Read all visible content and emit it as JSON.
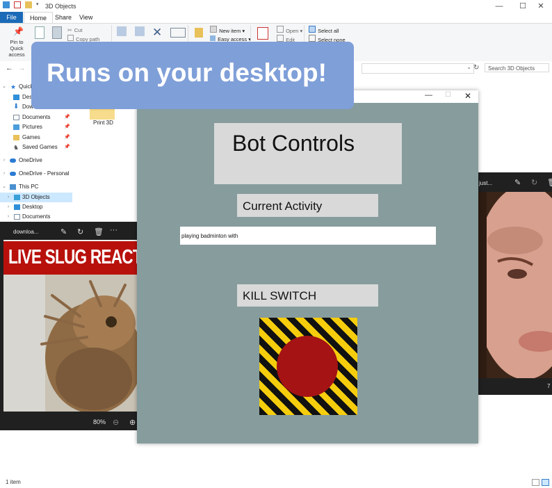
{
  "explorer": {
    "window_title": "3D Objects",
    "tabs": [
      "File",
      "Home",
      "Share",
      "View"
    ],
    "ribbon": {
      "pin_label": "Pin to Quick access",
      "copy_label": "Copy",
      "paste_label": "Paste",
      "cut_label": "Cut",
      "copy_path_label": "Copy path",
      "move_to_label": "Move",
      "copy_to_label": "Copy",
      "delete_label": "Delete",
      "rename_label": "Rename",
      "new_folder_label": "New",
      "new_item_label": "New item",
      "easy_access_label": "Easy access",
      "properties_label": "Properties",
      "open_label": "Open",
      "edit_label": "Edit",
      "select_all_label": "Select all",
      "select_none_label": "Select none"
    },
    "search_placeholder": "Search 3D Objects",
    "nav": [
      {
        "label": "Quick",
        "pinned": false
      },
      {
        "label": "Des",
        "pinned": false
      },
      {
        "label": "Dow",
        "pinned": false
      },
      {
        "label": "Documents",
        "pinned": true
      },
      {
        "label": "Pictures",
        "pinned": true
      },
      {
        "label": "Games",
        "pinned": true
      },
      {
        "label": "Saved Games",
        "pinned": true
      },
      {
        "label": "OneDrive",
        "pinned": false
      },
      {
        "label": "OneDrive - Personal",
        "pinned": false
      },
      {
        "label": "This PC",
        "pinned": false
      },
      {
        "label": "3D Objects",
        "pinned": false
      },
      {
        "label": "Desktop",
        "pinned": false
      },
      {
        "label": "Documents",
        "pinned": false
      }
    ],
    "folder_label": "Print 3D",
    "status": "1 item"
  },
  "photo_left": {
    "title": "downloa...",
    "image_text": "LIVE SLUG REACT",
    "zoom": "80%"
  },
  "photo_right": {
    "title": "just...",
    "number_partial": "7"
  },
  "bot_window": {
    "title": "Bot Controls",
    "activity_label": "Current Activity",
    "activity_value": "playing badminton with",
    "killswitch_label": "KILL SWITCH"
  },
  "promo": {
    "text": "Runs on your desktop!"
  },
  "colors": {
    "explorer_accent": "#1a6ab8",
    "bot_background": "#879c9d",
    "bot_panel": "#d9d9d9",
    "kill_button_red": "#a51314",
    "hazard_yellow": "#f5cd0c",
    "promo_banner": "#7f9fd8"
  }
}
